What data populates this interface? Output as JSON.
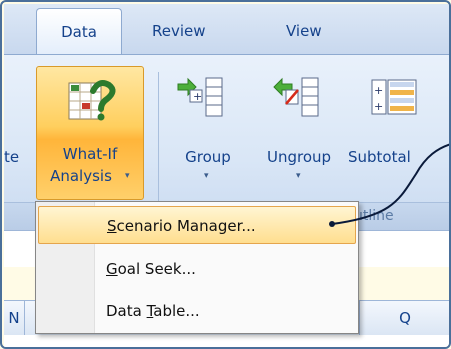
{
  "tabs": [
    {
      "label": "Data",
      "active": true
    },
    {
      "label": "Review",
      "active": false
    },
    {
      "label": "View",
      "active": false
    }
  ],
  "ribbon": {
    "partial_left_label": "te",
    "whatif": {
      "line1": "What-If",
      "line2": "Analysis",
      "arrow": "▾"
    },
    "group": {
      "label": "Group",
      "arrow": "▾"
    },
    "ungroup": {
      "label": "Ungroup",
      "arrow": "▾"
    },
    "subtotal": {
      "label": "Subtotal"
    },
    "outline_group_label": "utline"
  },
  "menu": {
    "items": [
      {
        "pre": "",
        "accel": "S",
        "post": "cenario Manager...",
        "highlighted": true
      },
      {
        "pre": "",
        "accel": "G",
        "post": "oal Seek...",
        "highlighted": false
      },
      {
        "pre": "Data ",
        "accel": "T",
        "post": "able...",
        "highlighted": false
      }
    ]
  },
  "sheet": {
    "column_headers": [
      "N",
      "Q"
    ]
  },
  "colors": {
    "accent": "#15428b",
    "highlight": "#ffde8f",
    "callout": "#0a1a3a"
  }
}
